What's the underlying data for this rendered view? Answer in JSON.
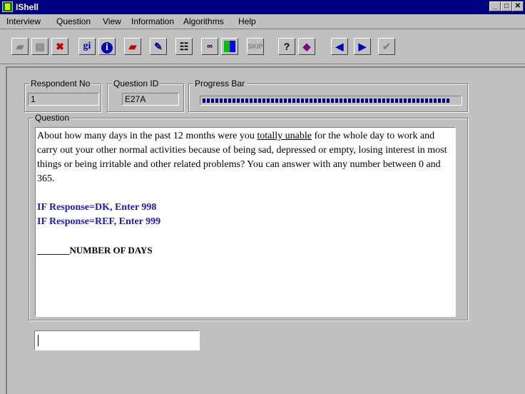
{
  "window": {
    "title": "IShell"
  },
  "menu": [
    "Interview",
    "Question",
    "View",
    "Information",
    "Algorithms",
    "Help"
  ],
  "toolbar_icons": [
    "book-icon",
    "notebook-icon",
    "delete-icon",
    "gi-icon",
    "info-icon",
    "red-book-icon",
    "edit-icon",
    "list-check-icon",
    "glasses-icon",
    "color-grid-icon",
    "skip-icon",
    "help-icon",
    "help-book-icon",
    "previous-icon",
    "next-icon",
    "check-icon"
  ],
  "toolbar_labels": {
    "gi": "gi",
    "info": "i",
    "help": "?"
  },
  "respondent": {
    "label": "Respondent No",
    "value": "1"
  },
  "question_id": {
    "label": "Question ID",
    "value": "E27A"
  },
  "progress": {
    "label": "Progress Bar",
    "fraction": 0.96
  },
  "question": {
    "label": "Question",
    "text_before": "About how many days in the past 12 months were you ",
    "text_underlined": "totally unable",
    "text_after": " for the whole day to work and carry out your other normal activities because of being sad, depressed or empty, losing interest in most things or being irritable and other related problems? You can answer with any number between 0 and 365.",
    "instruction_dk": "IF Response=DK, Enter 998",
    "instruction_ref": "IF Response=REF, Enter 999",
    "answer_blank": "_______",
    "answer_label": "NUMBER OF DAYS"
  },
  "response": {
    "value": ""
  }
}
